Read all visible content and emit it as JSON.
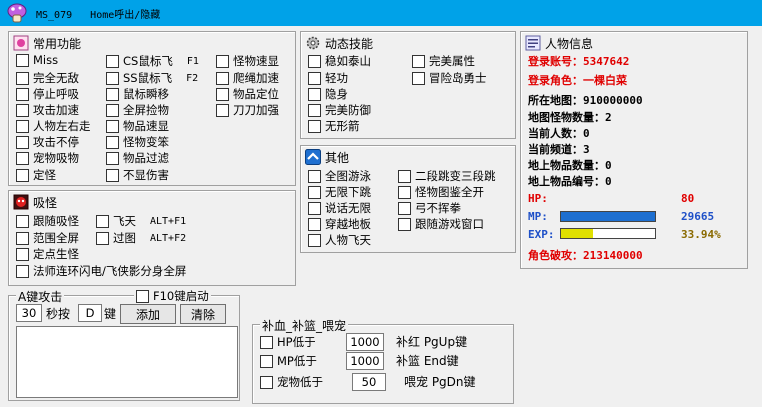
{
  "window": {
    "title": "MS_079   Home呼出/隐藏",
    "accent": "#00a2e8"
  },
  "common": {
    "title": "常用功能",
    "items": [
      {
        "label": "Miss"
      },
      {
        "label": "完全无敌"
      },
      {
        "label": "停止呼吸"
      },
      {
        "label": "攻击加速"
      },
      {
        "label": "人物左右走"
      },
      {
        "label": "攻击不停"
      },
      {
        "label": "宠物吸物"
      },
      {
        "label": "定怪"
      },
      {
        "label": "CS鼠标飞",
        "hotkey": "F1"
      },
      {
        "label": "SS鼠标飞",
        "hotkey": "F2"
      },
      {
        "label": "鼠标瞬移"
      },
      {
        "label": "全屏捡物"
      },
      {
        "label": "物品速显"
      },
      {
        "label": "怪物变笨"
      },
      {
        "label": "物品过滤"
      },
      {
        "label": "不显伤害"
      },
      {
        "label": "怪物速显"
      },
      {
        "label": "爬绳加速"
      },
      {
        "label": "物品定位"
      },
      {
        "label": "刀刀加强"
      }
    ]
  },
  "vacuum": {
    "title": "吸怪",
    "follow": "跟随吸怪",
    "fly": "飞天",
    "fly_hotkey": "ALT+F1",
    "fullscreen": "范围全屏",
    "pass_map": "过图",
    "pass_hotkey": "ALT+F2",
    "fixed_spawn": "定点生怪",
    "mage": "法师连环闪电/飞侠影分身全屏"
  },
  "dynamic": {
    "title": "动态技能",
    "items": [
      {
        "label": "稳如泰山"
      },
      {
        "label": "完美属性"
      },
      {
        "label": "轻功"
      },
      {
        "label": "冒险岛勇士"
      },
      {
        "label": "隐身"
      },
      {
        "label": "完美防御"
      },
      {
        "label": "无形箭"
      }
    ]
  },
  "other": {
    "title": "其他",
    "items": [
      {
        "label": "全图游泳"
      },
      {
        "label": "二段跳变三段跳"
      },
      {
        "label": "无限下跳"
      },
      {
        "label": "怪物图鉴全开"
      },
      {
        "label": "说话无限"
      },
      {
        "label": "弓不挥拳"
      },
      {
        "label": "穿越地板"
      },
      {
        "label": "跟随游戏窗口"
      },
      {
        "label": "人物飞天"
      }
    ]
  },
  "char": {
    "title": "人物信息",
    "account_label": "登录账号：",
    "account": "5347642",
    "role_label": "登录角色：",
    "role": "一棵白菜",
    "map_label": "所在地图：",
    "map": "910000000",
    "monsters_label": "地图怪物数量：",
    "monsters": "2",
    "people_label": "当前人数：",
    "people": "0",
    "channel_label": "当前频道：",
    "channel": "3",
    "items_label": "地上物品数量：",
    "items": "0",
    "item_id_label": "地上物品编号：",
    "item_id": "0",
    "hp_label": "HP:",
    "hp": "80",
    "hp_fill": 0,
    "mp_label": "MP:",
    "mp": "29665",
    "mp_fill": 1.0,
    "exp_label": "EXP:",
    "exp": "33.94%",
    "exp_fill": 0.3394,
    "break_label": "角色破攻：",
    "break": "213140000"
  },
  "attack": {
    "legend": "A键攻击",
    "f10_label": "F10键启动",
    "seconds_value": "30",
    "seconds_label": "秒按",
    "key_value": "D",
    "key_label": "键",
    "add": "添加",
    "clear": "清除"
  },
  "supply": {
    "legend": "补血_补篮_喂宠",
    "hp_label": "HP低于",
    "hp_value": "1000",
    "hp_key": "补红 PgUp键",
    "mp_label": "MP低于",
    "mp_value": "1000",
    "mp_key": "补篮 End键",
    "pet_label": "宠物低于",
    "pet_value": "50",
    "pet_key": "喂宠 PgDn键"
  }
}
